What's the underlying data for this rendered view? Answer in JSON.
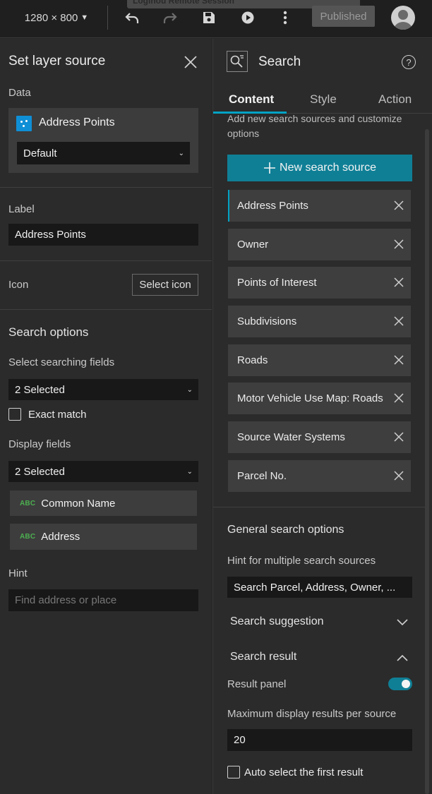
{
  "topbar": {
    "screen_size": "1280 × 800",
    "ghost_text": "Loginou Remote Session",
    "published_label": "Published"
  },
  "left_panel": {
    "title": "Set layer source",
    "data_label": "Data",
    "layer_name": "Address Points",
    "view_select": "Default",
    "label_label": "Label",
    "label_value": "Address Points",
    "icon_label": "Icon",
    "select_icon_button": "Select icon",
    "search_options_heading": "Search options",
    "searching_fields_label": "Select searching fields",
    "searching_fields_value": "2 Selected",
    "exact_match_label": "Exact match",
    "exact_match_checked": false,
    "display_fields_label": "Display fields",
    "display_fields_value": "2 Selected",
    "display_fields": [
      {
        "type": "ABC",
        "name": "Common Name"
      },
      {
        "type": "ABC",
        "name": "Address"
      }
    ],
    "hint_label": "Hint",
    "hint_placeholder": "Find address or place"
  },
  "right_panel": {
    "title": "Search",
    "tabs": [
      "Content",
      "Style",
      "Action"
    ],
    "active_tab": "Content",
    "description": "Add new search sources and customize options",
    "new_source_button": "New search source",
    "sources": [
      "Address Points",
      "Owner",
      "Points of Interest",
      "Subdivisions",
      "Roads",
      "Motor Vehicle Use Map: Roads",
      "Source Water Systems",
      "Parcel No."
    ],
    "general_heading": "General search options",
    "hint_multi_label": "Hint for multiple search sources",
    "hint_multi_value": "Search Parcel, Address, Owner, ...",
    "suggestion_label": "Search suggestion",
    "result_label": "Search result",
    "result_panel_label": "Result panel",
    "result_panel_on": true,
    "max_results_label": "Maximum display results per source",
    "max_results_value": "20",
    "auto_select_label": "Auto select the first result",
    "auto_select_checked": false
  },
  "colors": {
    "accent": "#00a3c4",
    "primary_button": "#0f7f96",
    "layer_icon": "#0f8fd6",
    "field_type": "#4caf50"
  }
}
